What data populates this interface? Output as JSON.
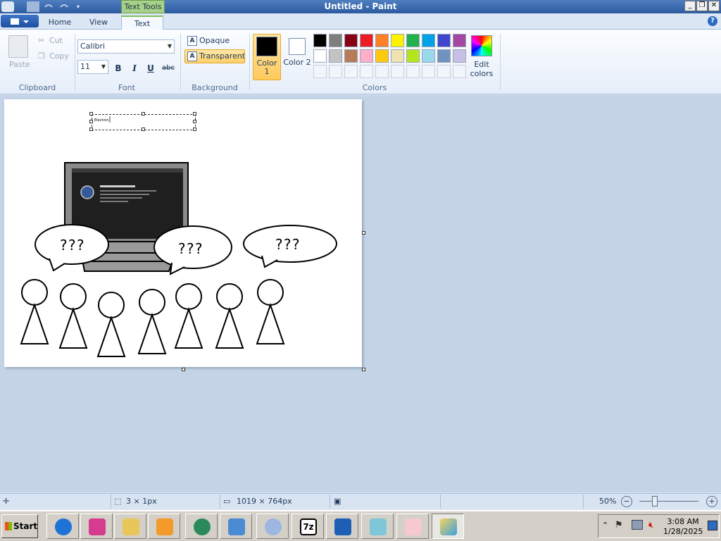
{
  "window": {
    "title": "Untitled - Paint",
    "context_tab": "Text Tools",
    "buttons": [
      "_",
      "❐",
      "✕"
    ]
  },
  "tabs": [
    {
      "label": "Home"
    },
    {
      "label": "View"
    },
    {
      "label": "Text"
    }
  ],
  "ribbon": {
    "clipboard": {
      "group_label": "Clipboard",
      "paste": "Paste",
      "cut": "Cut",
      "copy": "Copy"
    },
    "font": {
      "group_label": "Font",
      "family": "Calibri",
      "size": "11",
      "bold": "B",
      "italic": "I",
      "underline": "U",
      "strike": "abc"
    },
    "background": {
      "group_label": "Background",
      "opaque": "Opaque",
      "transparent": "Transparent"
    },
    "colors": {
      "group_label": "Colors",
      "color1_label": "Color 1",
      "color2_label": "Color 2",
      "edit_label": "Edit colors",
      "color1": "#000000",
      "color2": "#ffffff",
      "row1": [
        "#000000",
        "#7f7f7f",
        "#880015",
        "#ed1c24",
        "#ff7f27",
        "#fff200",
        "#22b14c",
        "#00a2e8",
        "#3f48cc",
        "#a349a4"
      ],
      "row2": [
        "#ffffff",
        "#c3c3c3",
        "#b97a57",
        "#ffaec9",
        "#ffc90e",
        "#efe4b0",
        "#b5e61d",
        "#99d9ea",
        "#7092be",
        "#c8bfe7"
      ]
    }
  },
  "canvas": {
    "text_box_content": "Electron"
  },
  "drawing": {
    "bubble_text": "???",
    "bubble_count": 3,
    "person_count": 7
  },
  "status": {
    "selection_size": "3 × 1px",
    "image_size": "1019 × 764px",
    "zoom": "50%"
  },
  "taskbar": {
    "start_label": "Start",
    "clock_time": "3:08 AM",
    "clock_date": "1/28/2025"
  }
}
